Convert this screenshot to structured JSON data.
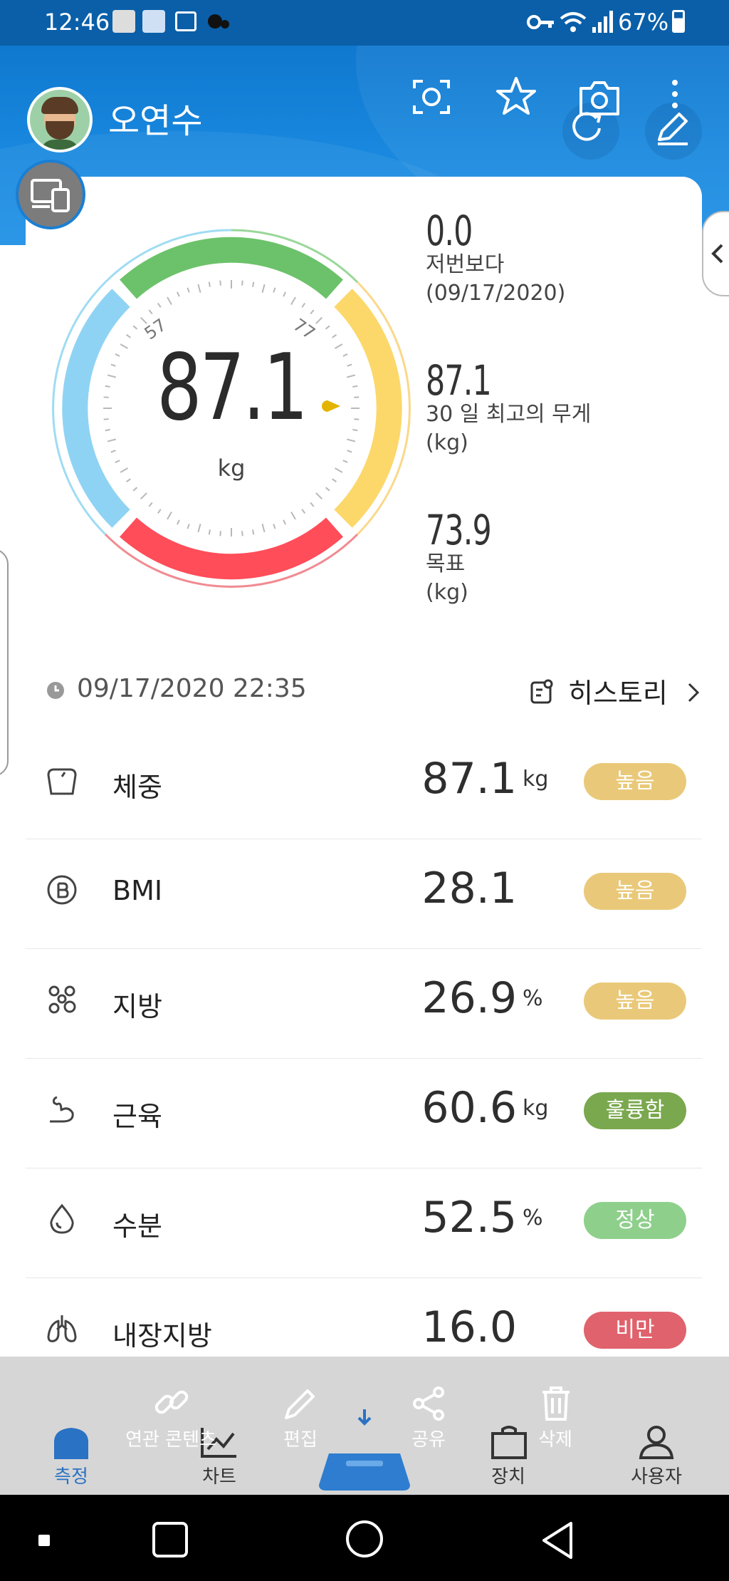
{
  "status_bar": {
    "time": "12:46",
    "battery": "67%"
  },
  "header": {
    "user_name": "오연수"
  },
  "gauge": {
    "value": "87.1",
    "unit": "kg",
    "tick_low": "57",
    "tick_high": "77"
  },
  "stats": [
    {
      "value": "0.0",
      "label": "저번보다",
      "sub": "(09/17/2020)"
    },
    {
      "value": "87.1",
      "label": "30 일 최고의 무게",
      "sub": "(kg)"
    },
    {
      "value": "73.9",
      "label": "목표",
      "sub": "(kg)"
    }
  ],
  "measurement": {
    "datetime": "09/17/2020 22:35",
    "history_label": "히스토리"
  },
  "metrics": [
    {
      "label": "체중",
      "value": "87.1",
      "unit": "kg",
      "status": "높음",
      "color": "#e9c979"
    },
    {
      "label": "BMI",
      "value": "28.1",
      "unit": "",
      "status": "높음",
      "color": "#e9c979"
    },
    {
      "label": "지방",
      "value": "26.9",
      "unit": "%",
      "status": "높음",
      "color": "#e9c979"
    },
    {
      "label": "근육",
      "value": "60.6",
      "unit": "kg",
      "status": "훌륭함",
      "color": "#7aa84e"
    },
    {
      "label": "수분",
      "value": "52.5",
      "unit": "%",
      "status": "정상",
      "color": "#8ecf8c"
    },
    {
      "label": "내장지방",
      "value": "16.0",
      "unit": "",
      "status": "비만",
      "color": "#e0626c"
    }
  ],
  "actions": [
    {
      "label": "연관 콘텐츠",
      "icon": "link-icon"
    },
    {
      "label": "편집",
      "icon": "pencil-icon"
    },
    {
      "label": "공유",
      "icon": "share-icon"
    },
    {
      "label": "삭제",
      "icon": "trash-icon"
    }
  ],
  "tabs": [
    {
      "label": "측정",
      "icon": "home-icon",
      "active": true
    },
    {
      "label": "차트",
      "icon": "chart-icon",
      "active": false
    },
    {
      "label": "장치",
      "icon": "bag-icon",
      "active": false
    },
    {
      "label": "사용자",
      "icon": "user-icon",
      "active": false
    }
  ],
  "colors": {
    "accent": "#1a7fd4",
    "green": "#6cc26a",
    "blue": "#8fd3f4",
    "yellow": "#fcd86b",
    "red": "#ff4d5a"
  }
}
